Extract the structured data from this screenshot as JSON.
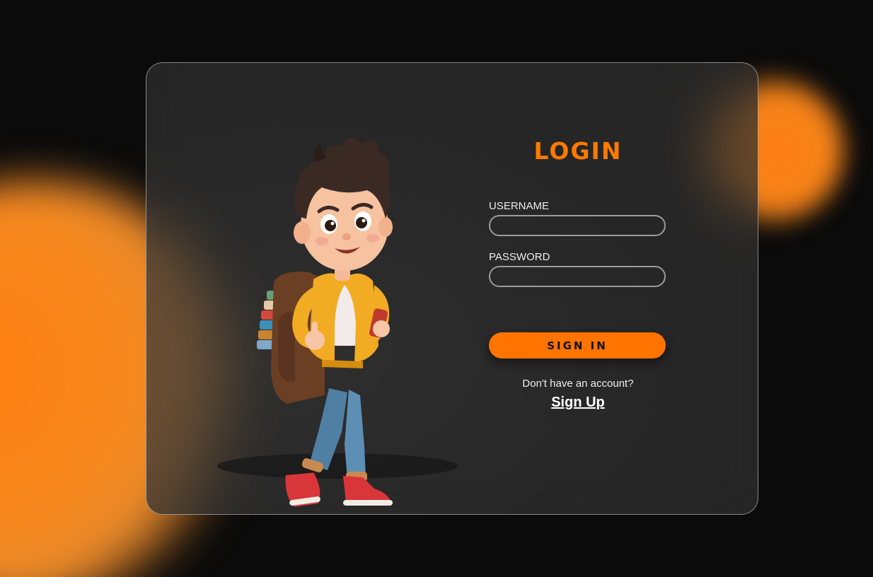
{
  "colors": {
    "background": "#0b0b0b",
    "accent": "#ff7a00",
    "card": "#303030"
  },
  "login": {
    "title": "LOGIN",
    "username_label": "USERNAME",
    "username_value": "",
    "password_label": "PASSWORD",
    "password_value": "",
    "signin_label": "SIGN IN",
    "account_prompt": "Don't have an account?",
    "signup_label": "Sign Up"
  },
  "illustration": {
    "icon": "student-character-illustration"
  }
}
